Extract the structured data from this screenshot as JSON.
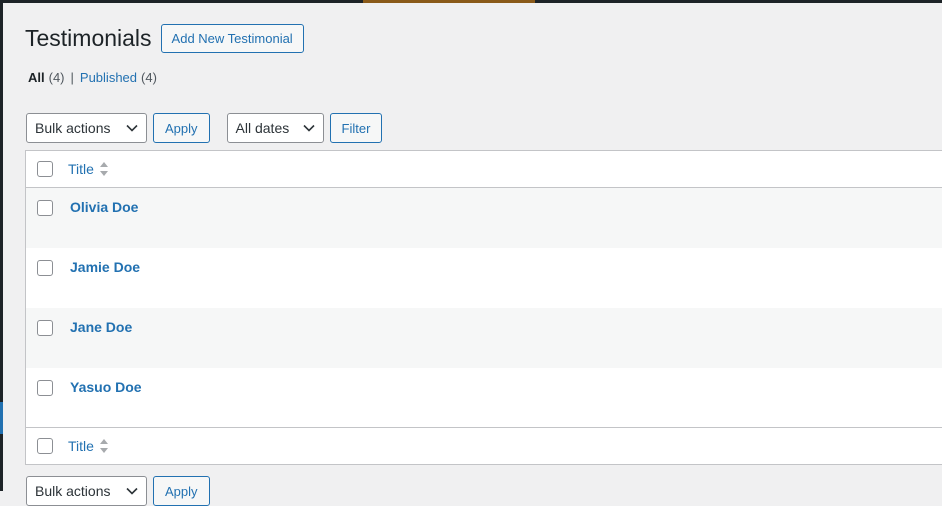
{
  "page": {
    "title": "Testimonials",
    "add_new_label": "Add New Testimonial"
  },
  "views": {
    "all_label": "All",
    "all_count": "(4)",
    "separator": "|",
    "published_label": "Published",
    "published_count": "(4)"
  },
  "tablenav_top": {
    "bulk_actions": "Bulk actions",
    "apply_label": "Apply",
    "dates_filter": "All dates",
    "filter_label": "Filter"
  },
  "table": {
    "column_title": "Title",
    "rows": [
      {
        "name": "Olivia Doe"
      },
      {
        "name": "Jamie Doe"
      },
      {
        "name": "Jane Doe"
      },
      {
        "name": "Yasuo Doe"
      }
    ]
  },
  "tablenav_bottom": {
    "bulk_actions": "Bulk actions",
    "apply_label": "Apply"
  },
  "colors": {
    "accent": "#2271b1",
    "background": "#f0f0f1",
    "admin_bar": "#1d2327"
  }
}
